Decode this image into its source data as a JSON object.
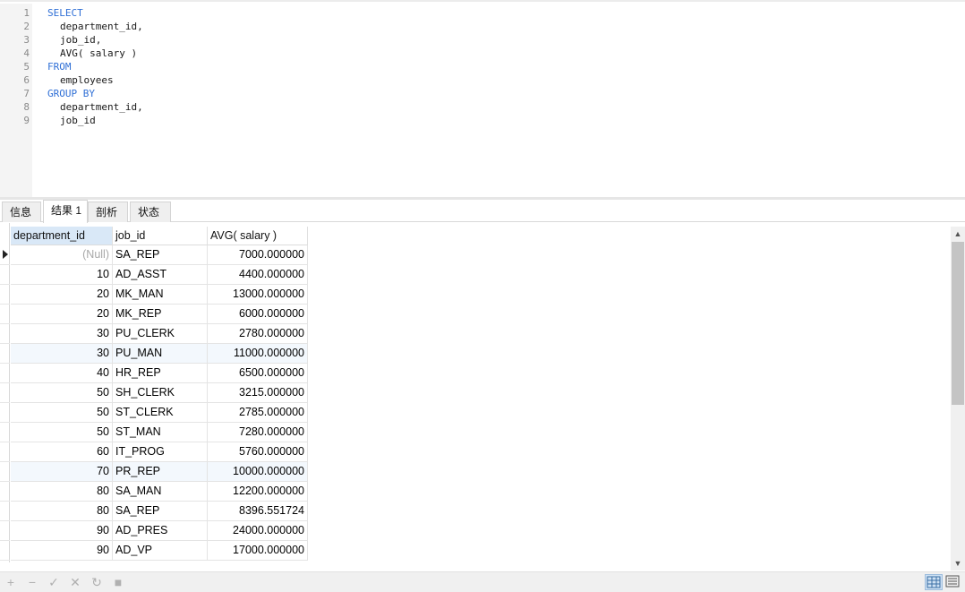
{
  "editor": {
    "lines": [
      {
        "no": "1",
        "text": "SELECT",
        "kind": "keyword"
      },
      {
        "no": "2",
        "text": "department_id,",
        "kind": "ident"
      },
      {
        "no": "3",
        "text": "job_id,",
        "kind": "ident"
      },
      {
        "no": "4",
        "text": "AVG( salary )",
        "kind": "ident"
      },
      {
        "no": "5",
        "text": "FROM",
        "kind": "keyword"
      },
      {
        "no": "6",
        "text": "employees",
        "kind": "ident"
      },
      {
        "no": "7",
        "text": "GROUP BY",
        "kind": "keyword"
      },
      {
        "no": "8",
        "text": "department_id,",
        "kind": "ident"
      },
      {
        "no": "9",
        "text": "job_id",
        "kind": "ident"
      }
    ]
  },
  "tabs": [
    {
      "label": "信息",
      "active": false
    },
    {
      "label": "结果 1",
      "active": true
    },
    {
      "label": "剖析",
      "active": false
    },
    {
      "label": "状态",
      "active": false
    }
  ],
  "grid": {
    "columns": [
      "department_id",
      "job_id",
      "AVG( salary )"
    ],
    "rows": [
      {
        "department_id": "(Null)",
        "job_id": "SA_REP",
        "avg": "7000.000000"
      },
      {
        "department_id": "10",
        "job_id": "AD_ASST",
        "avg": "4400.000000"
      },
      {
        "department_id": "20",
        "job_id": "MK_MAN",
        "avg": "13000.000000"
      },
      {
        "department_id": "20",
        "job_id": "MK_REP",
        "avg": "6000.000000"
      },
      {
        "department_id": "30",
        "job_id": "PU_CLERK",
        "avg": "2780.000000"
      },
      {
        "department_id": "30",
        "job_id": "PU_MAN",
        "avg": "11000.000000"
      },
      {
        "department_id": "40",
        "job_id": "HR_REP",
        "avg": "6500.000000"
      },
      {
        "department_id": "50",
        "job_id": "SH_CLERK",
        "avg": "3215.000000"
      },
      {
        "department_id": "50",
        "job_id": "ST_CLERK",
        "avg": "2785.000000"
      },
      {
        "department_id": "50",
        "job_id": "ST_MAN",
        "avg": "7280.000000"
      },
      {
        "department_id": "60",
        "job_id": "IT_PROG",
        "avg": "5760.000000"
      },
      {
        "department_id": "70",
        "job_id": "PR_REP",
        "avg": "10000.000000"
      },
      {
        "department_id": "80",
        "job_id": "SA_MAN",
        "avg": "12200.000000"
      },
      {
        "department_id": "80",
        "job_id": "SA_REP",
        "avg": "8396.551724"
      },
      {
        "department_id": "90",
        "job_id": "AD_PRES",
        "avg": "24000.000000"
      },
      {
        "department_id": "90",
        "job_id": "AD_VP",
        "avg": "17000.000000"
      }
    ],
    "scroll_visible_fraction": 0.52
  },
  "toolbar": {
    "buttons": [
      {
        "icon": "plus-icon",
        "glyph": "+"
      },
      {
        "icon": "minus-icon",
        "glyph": "−"
      },
      {
        "icon": "check-icon",
        "glyph": "✓"
      },
      {
        "icon": "close-icon",
        "glyph": "✕"
      },
      {
        "icon": "refresh-icon",
        "glyph": "↻"
      },
      {
        "icon": "stop-icon",
        "glyph": "■"
      }
    ]
  },
  "colors": {
    "keyword": "#2f6fd6",
    "selected_header": "#d9e8f7",
    "alt_row": "#f3f8fd",
    "null_text": "#a8a8a8"
  }
}
